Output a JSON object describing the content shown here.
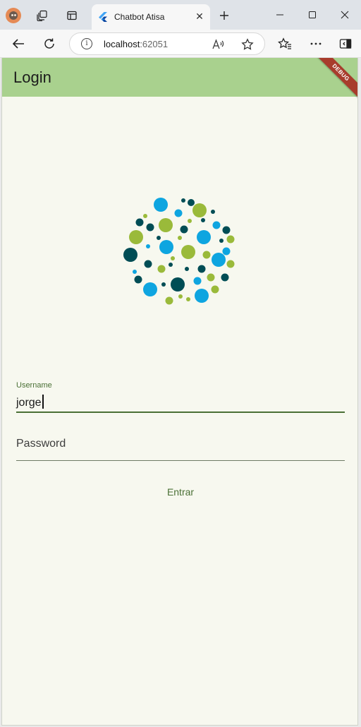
{
  "browser": {
    "tab_title": "Chatbot Atisa",
    "address": {
      "host": "localhost",
      "port": ":62051"
    },
    "icons": {
      "profile": "avatar-icon",
      "workspaces": "workspaces-icon",
      "tab_actions": "tab-actions-icon",
      "tab_favicon": "flutter-icon",
      "tab_close": "close-icon",
      "new_tab": "plus-icon",
      "minimize": "minimize-icon",
      "maximize": "maximize-icon",
      "close_window": "close-window-icon",
      "back": "back-icon",
      "refresh": "refresh-icon",
      "site_info": "info-icon",
      "read_aloud": "read-aloud-icon",
      "favorite": "star-icon",
      "favorites": "favorites-icon",
      "more": "more-icon",
      "sidebar": "sidebar-icon"
    }
  },
  "app": {
    "title": "Login",
    "debug_label": "DEBUG",
    "username": {
      "label": "Username",
      "value": "jorge"
    },
    "password": {
      "placeholder": "Password",
      "value": ""
    },
    "submit_label": "Entrar",
    "colors": {
      "appbar": "#a9d18e",
      "background": "#f7f8ef",
      "accent": "#4a7035",
      "logo_blue": "#0ea5e0",
      "logo_green": "#9aba3a",
      "logo_teal": "#004d55"
    }
  }
}
